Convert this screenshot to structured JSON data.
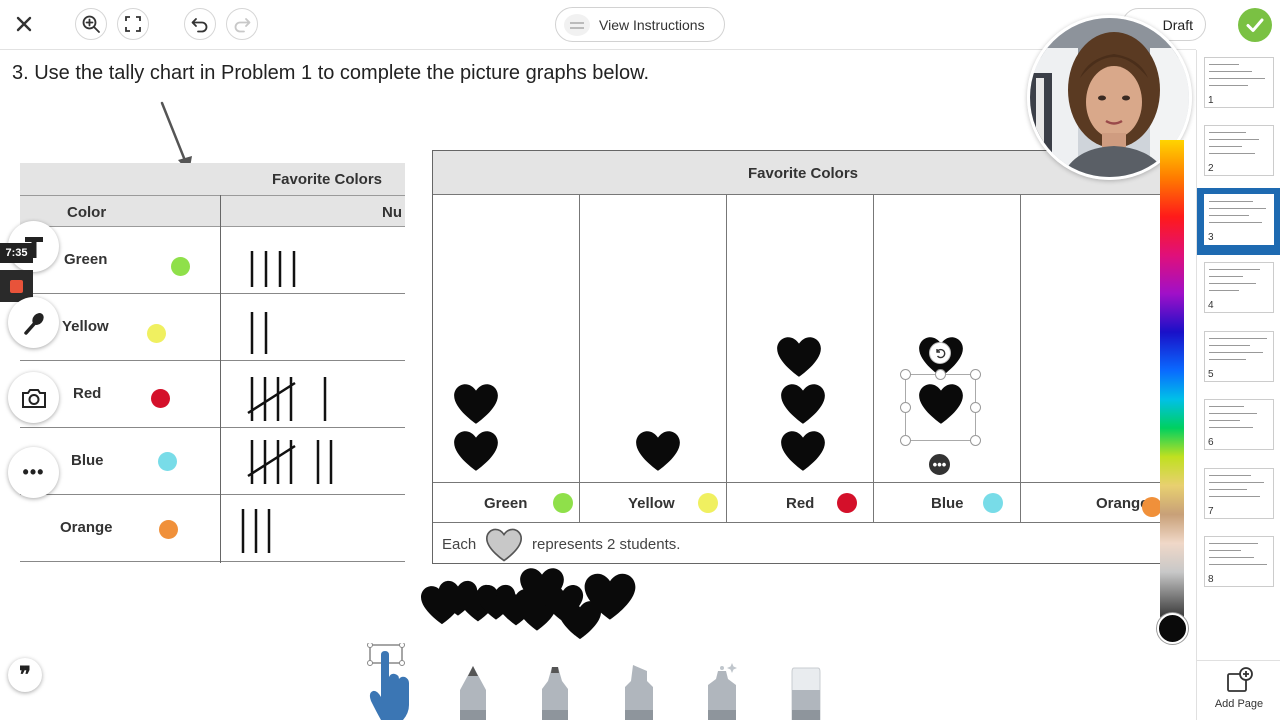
{
  "toolbar": {
    "view_instructions_label": "View Instructions",
    "draft_label": "Draft"
  },
  "prompt": {
    "text": "3. Use the tally chart in Problem 1 to complete the picture graphs below."
  },
  "tally_chart": {
    "title": "Favorite Colors",
    "header_color": "Color",
    "header_number": "Nu",
    "rows": [
      {
        "label": "Green",
        "color": "#8fe04a",
        "tally": 4
      },
      {
        "label": "Yellow",
        "color": "#f0f060",
        "tally": 2
      },
      {
        "label": "Red",
        "color": "#d4102a",
        "tally": 6
      },
      {
        "label": "Blue",
        "color": "#78dce8",
        "tally": 7
      },
      {
        "label": "Orange",
        "color": "#f0903a",
        "tally": 3
      }
    ]
  },
  "picture_graph": {
    "title": "Favorite Colors",
    "columns": [
      {
        "label": "Green",
        "color": "#8fe04a",
        "hearts": 2
      },
      {
        "label": "Yellow",
        "color": "#f0f060",
        "hearts": 1
      },
      {
        "label": "Red",
        "color": "#d4102a",
        "hearts": 3
      },
      {
        "label": "Blue",
        "color": "#78dce8",
        "hearts": 2
      },
      {
        "label": "Orange",
        "color": "#f0903a",
        "hearts": 0
      }
    ],
    "key_each": "Each",
    "key_represents": "represents 2 students."
  },
  "recording": {
    "timer": "7:35"
  },
  "pages": {
    "items": [
      "1",
      "2",
      "3",
      "4",
      "5",
      "6",
      "7",
      "8"
    ],
    "active": "3",
    "add_label": "Add Page"
  },
  "colors": {
    "accent": "#1e6ab1",
    "check_green": "#7ac143",
    "record_red": "#e8533a",
    "pen_blue": "#3b76b4"
  },
  "icons": [
    "close-icon",
    "zoom-in-icon",
    "fullscreen-icon",
    "undo-icon",
    "redo-icon",
    "checkmark-icon",
    "text-tool-icon",
    "microphone-icon",
    "camera-icon",
    "more-icon",
    "quote-icon",
    "hand-select-icon",
    "pencil-icon",
    "marker-icon",
    "highlighter-icon",
    "glitter-pen-icon",
    "eraser-icon",
    "add-page-icon"
  ]
}
